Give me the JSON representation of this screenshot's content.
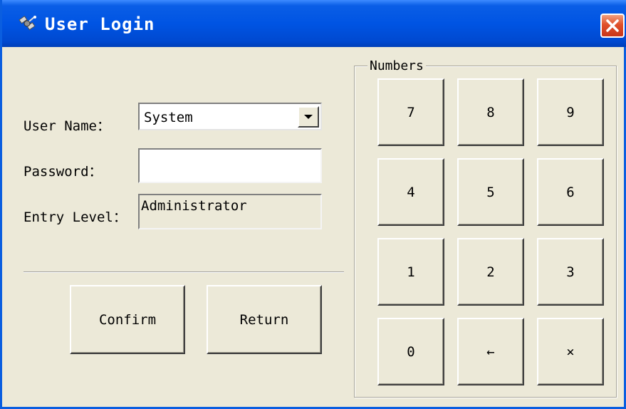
{
  "window": {
    "title": "User Login"
  },
  "form": {
    "username_label": "User Name：",
    "username_value": "System",
    "password_label": "Password：",
    "password_value": "",
    "level_label": "Entry Level：",
    "level_value": "Administrator"
  },
  "actions": {
    "confirm_label": "Confirm",
    "return_label": "Return"
  },
  "numbers": {
    "legend": "Numbers",
    "keys": [
      "7",
      "8",
      "9",
      "4",
      "5",
      "6",
      "1",
      "2",
      "3",
      "0",
      "←",
      "×"
    ]
  },
  "colors": {
    "titlebar": "#0054e3",
    "window_bg": "#ece9d8",
    "close_button": "#e0502a"
  },
  "icons": {
    "app": "satellite-icon",
    "close": "close-icon",
    "dropdown": "chevron-down-icon"
  }
}
